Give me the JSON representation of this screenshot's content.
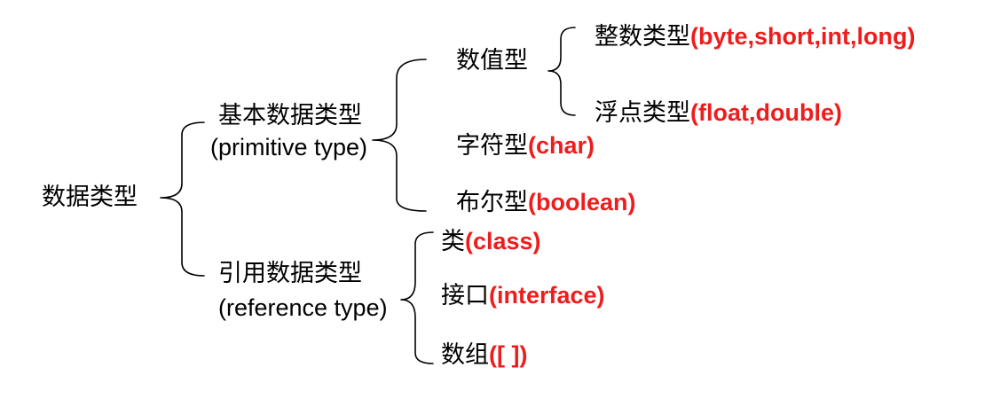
{
  "root": {
    "label": "数据类型"
  },
  "primitive": {
    "label": "基本数据类型",
    "sub": "(primitive type)",
    "numeric": {
      "label": "数值型",
      "integer": {
        "label": "整数类型",
        "types": "(byte,short,int,long)"
      },
      "float": {
        "label": "浮点类型",
        "types": "(float,double)"
      }
    },
    "char": {
      "label": "字符型",
      "types": "(char)"
    },
    "boolean": {
      "label": "布尔型",
      "types": "(boolean)"
    }
  },
  "reference": {
    "label": "引用数据类型",
    "sub": "(reference type)",
    "class": {
      "label": "类",
      "types": "(class)"
    },
    "interface": {
      "label": "接口",
      "types": "(interface)"
    },
    "array": {
      "label": "数组",
      "types": "([ ])"
    }
  },
  "colors": {
    "keyword": "#ee1d1d",
    "text": "#000000",
    "line": "#000000"
  }
}
